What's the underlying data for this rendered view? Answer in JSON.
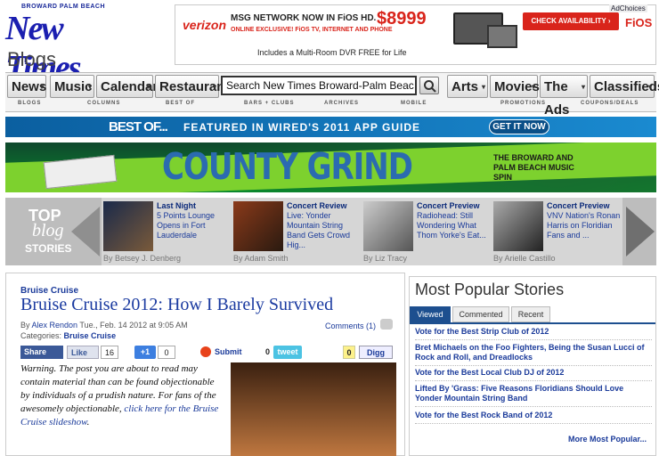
{
  "brand": {
    "city": "BROWARD PALM BEACH",
    "name": "New Times",
    "section": "Blogs"
  },
  "ad": {
    "brand": "verizon",
    "headline": "MSG NETWORK NOW IN FiOS HD.",
    "sub": "ONLINE EXCLUSIVE! FiOS TV, INTERNET AND PHONE",
    "price": "$8999",
    "dvr": "Includes a Multi-Room DVR FREE for Life",
    "cta": "CHECK AVAILABILITY ›",
    "adchoices": "AdChoices",
    "fios": "FiOS"
  },
  "nav": {
    "items": [
      "News",
      "Music",
      "Calendar",
      "Restaurants",
      "Arts",
      "Movies",
      "The Ads",
      "Classifieds"
    ],
    "subitems": [
      "BLOGS",
      "COLUMNS",
      "BEST OF",
      "BARS + CLUBS",
      "ARCHIVES",
      "MOBILE",
      "PROMOTIONS",
      "COUPONS/DEALS"
    ],
    "search_value": "Search New Times Broward-Palm Beac"
  },
  "banners": {
    "best_logo": "BEST OF...",
    "best_text": "FEATURED IN WIRED'S 2011 APP GUIDE",
    "best_cta": "GET IT NOW",
    "grind_title": "COUNTY GRIND",
    "grind_tag": "THE BROWARD AND PALM BEACH MUSIC SPIN"
  },
  "top_stories": {
    "label_top": "TOP",
    "label_blog": "blog",
    "label_stories": "STORIES",
    "items": [
      {
        "kicker": "Last Night",
        "title": "5 Points Lounge Opens in Fort Lauderdale",
        "byline": "By Betsey J. Denberg"
      },
      {
        "kicker": "Concert Review",
        "title": "Live: Yonder Mountain String Band Gets Crowd Hig...",
        "byline": "By Adam Smith"
      },
      {
        "kicker": "Concert Preview",
        "title": "Radiohead: Still Wondering What Thom Yorke's Eat...",
        "byline": "By Liz Tracy"
      },
      {
        "kicker": "Concert Preview",
        "title": "VNV Nation's Ronan Harris on Floridian Fans and ...",
        "byline": "By Arielle Castillo"
      }
    ]
  },
  "article": {
    "category": "Bruise Cruise",
    "title": "Bruise Cruise 2012: How I Barely Survived",
    "by_prefix": "By",
    "author": "Alex Rendon",
    "date": "Tue., Feb. 14 2012 at 9:05 AM",
    "categories_label": "Categories:",
    "categories_value": "Bruise Cruise",
    "comments": "Comments (1)",
    "share": {
      "share_label": "Share",
      "like_label": "Like",
      "like_count": "16",
      "plus_label": "+1",
      "plus_count": "0",
      "submit_label": "Submit",
      "tweet_count": "0",
      "tweet_label": "tweet",
      "digg_count": "0",
      "digg_label": "Digg"
    },
    "body_text": "Warning. The post you are about to read may contain material than can be found objectionable by individuals of a prudish nature. For fans of the awesomely objectionable, ",
    "body_link": "click here for the Bruise Cruise slideshow",
    "body_end": "."
  },
  "popular": {
    "heading": "Most Popular Stories",
    "tabs": [
      "Viewed",
      "Commented",
      "Recent"
    ],
    "items": [
      "Vote for the Best Strip Club of 2012",
      "Bret Michaels on the Foo Fighters, Being the Susan Lucci of Rock and Roll, and Dreadlocks",
      "Vote for the Best Local Club DJ of 2012",
      "Lifted By 'Grass: Five Reasons Floridians Should Love Yonder Mountain String Band",
      "Vote for the Best Rock Band of 2012"
    ],
    "more": "More Most Popular..."
  }
}
